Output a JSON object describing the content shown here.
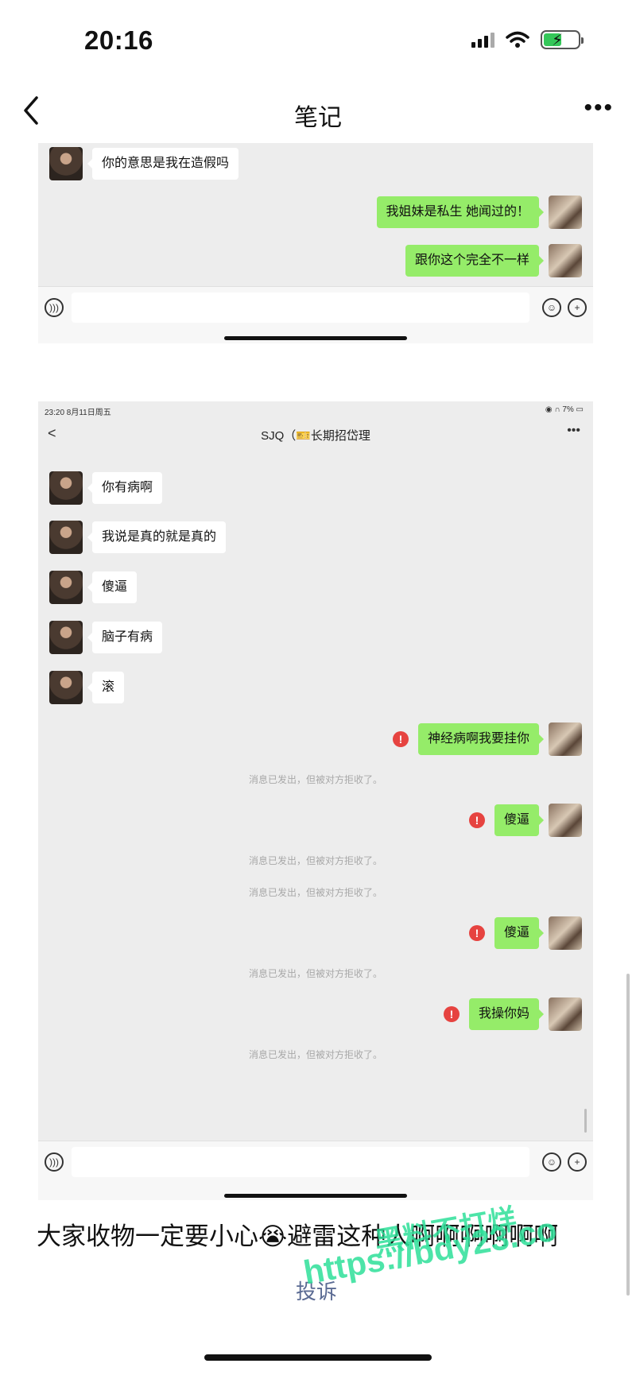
{
  "status_bar": {
    "time": "20:16"
  },
  "nav": {
    "title": "笔记"
  },
  "screenshot1": {
    "messages": [
      {
        "side": "left",
        "text": "你的意思是我在造假吗"
      },
      {
        "side": "right",
        "text": "我姐妹是私生 她闻过的！"
      },
      {
        "side": "right",
        "text": "跟你这个完全不一样"
      }
    ]
  },
  "screenshot2": {
    "mini_status_time": "23:20  8月11日周五",
    "mini_status_right": "7%",
    "chat_title": "SJQ（🎫长期招岱理",
    "messages": [
      {
        "side": "left",
        "text": "你有病啊"
      },
      {
        "side": "left",
        "text": "我说是真的就是真的"
      },
      {
        "side": "left",
        "text": "傻逼"
      },
      {
        "side": "left",
        "text": "脑子有病"
      },
      {
        "side": "left",
        "text": "滚"
      },
      {
        "side": "right",
        "text": "神经病啊我要挂你",
        "error": true
      },
      {
        "side": "right",
        "text": "傻逼",
        "error": true
      },
      {
        "side": "right",
        "text": "傻逼",
        "error": true
      },
      {
        "side": "right",
        "text": "我操你妈",
        "error": true
      }
    ],
    "rejected_note": "消息已发出，但被对方拒收了。"
  },
  "caption": "大家收物一定要小心😭避雷这种人啊啊啊啊啊啊",
  "report_link": "投诉",
  "watermark": {
    "line1": "黑料不打烊",
    "line2": "https://bdy23.co"
  },
  "colors": {
    "bubble_green": "#95ec69",
    "error_red": "#e64340",
    "watermark_green": "#2fe09a"
  }
}
